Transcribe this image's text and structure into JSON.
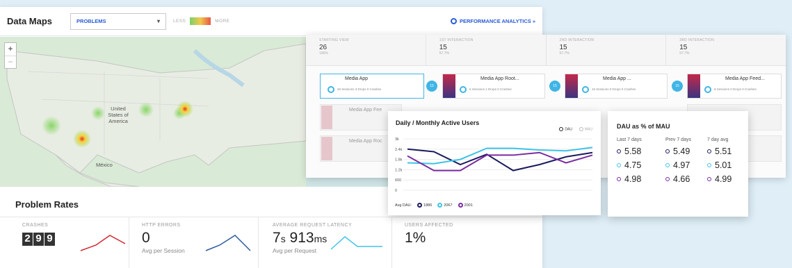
{
  "header": {
    "title": "Data Maps",
    "selector_value": "PROBLEMS",
    "legend_less": "LESS",
    "legend_more": "MORE",
    "perf_link": "PERFORMANCE ANALYTICS »"
  },
  "map": {
    "zoom_in": "+",
    "zoom_out": "−",
    "label_us": "United States of America",
    "label_mx": "México"
  },
  "problem_rates": {
    "title": "Problem Rates",
    "metrics": [
      {
        "label": "CRASHES",
        "digits": [
          "2",
          "9",
          "9"
        ],
        "color": "#d0262e"
      },
      {
        "label": "HTTP ERRORS",
        "value": "0",
        "sub": "Avg per Session",
        "color": "#2d5b9e"
      },
      {
        "label": "AVERAGE REQUEST LATENCY",
        "value_a": "7",
        "unit_a": "s",
        "value_b": "913",
        "unit_b": "ms",
        "sub": "Avg per Request",
        "color": "#3fc3e8"
      },
      {
        "label": "USERS AFFECTED",
        "value": "1%"
      }
    ]
  },
  "flow": {
    "steps": [
      {
        "label": "STARTING VIEW",
        "count": "26",
        "pct": "100%"
      },
      {
        "label": "1ST INTERACTION",
        "count": "15",
        "pct": "57.7%"
      },
      {
        "label": "2ND INTERACTION",
        "count": "15",
        "pct": "57.7%"
      },
      {
        "label": "3RD INTERACTION",
        "count": "15",
        "pct": "57.7%"
      }
    ],
    "nodes": [
      {
        "title": "Media App",
        "stats": "26 Sessions  3 Drops  0 Crashes"
      },
      {
        "title": "Media App Root...",
        "stats": "6 Sessions  1 Drops  0 Crashes"
      },
      {
        "title": "Media App ...",
        "stats": "15 Sessions  0 Drops  0 Crashes"
      },
      {
        "title": "Media App Feed...",
        "stats": "8 Sessions  0 Drops  0 Crashes"
      }
    ],
    "ghost_nodes": [
      "Media App Fee",
      "Media App Roc"
    ],
    "connector": "15"
  },
  "dau_chart": {
    "title": "Daily / Monthly Active Users",
    "legend_dau": "DAU",
    "legend_mau": "MAU",
    "avg_label": "Avg DAU:",
    "avgs": [
      {
        "value": "1886",
        "color": "#1a1a5e"
      },
      {
        "value": "2067",
        "color": "#3fc3e8"
      },
      {
        "value": "2001",
        "color": "#7a2ba0"
      }
    ]
  },
  "chart_data": {
    "type": "line",
    "title": "Daily / Monthly Active Users",
    "y_ticks": [
      "3k",
      "2.4k",
      "1.8k",
      "1.2k",
      "600",
      "0"
    ],
    "ylim": [
      0,
      3000
    ],
    "x": [
      0,
      1,
      2,
      3,
      4,
      5,
      6,
      7
    ],
    "series": [
      {
        "color": "#1a1a5e",
        "values": [
          2400,
          2250,
          1500,
          2100,
          1150,
          1500,
          1950,
          2200
        ]
      },
      {
        "color": "#3fc3e8",
        "values": [
          1600,
          1550,
          1800,
          2450,
          2450,
          2350,
          2300,
          2500
        ]
      },
      {
        "color": "#7a2ba0",
        "values": [
          2000,
          1150,
          1150,
          2050,
          2050,
          2200,
          1600,
          2050
        ]
      }
    ]
  },
  "dau_pct": {
    "title": "DAU as % of MAU",
    "headers": [
      "Last 7 days",
      "Prev 7 days",
      "7 day avg"
    ],
    "rows": [
      {
        "color": "#1a1a5e",
        "values": [
          "5.58",
          "5.49",
          "5.51"
        ]
      },
      {
        "color": "#3fc3e8",
        "values": [
          "4.75",
          "4.97",
          "5.01"
        ]
      },
      {
        "color": "#7a2ba0",
        "values": [
          "4.98",
          "4.66",
          "4.99"
        ]
      }
    ]
  }
}
